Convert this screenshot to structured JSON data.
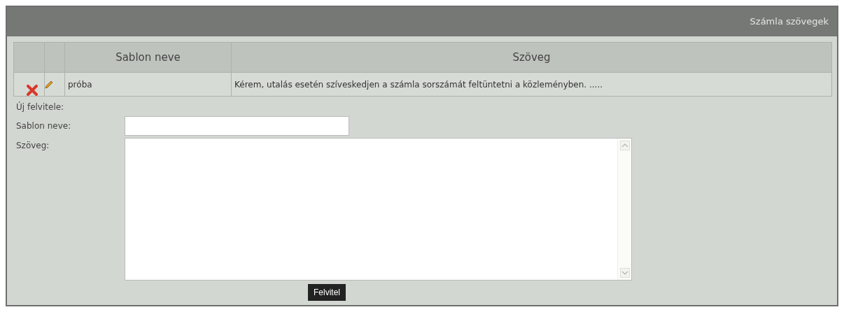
{
  "panel": {
    "title": "Számla szövegek"
  },
  "table": {
    "columns": [
      "",
      "",
      "Sablon neve",
      "Szöveg"
    ],
    "rows": [
      {
        "name": "próba",
        "text": "Kérem, utalás esetén szíveskedjen a számla sorszámát feltüntetni a közleményben. ....."
      }
    ]
  },
  "form": {
    "heading": "Új felvitele:",
    "name_label": "Sablon neve:",
    "text_label": "Szöveg:",
    "button": "Felvitel"
  }
}
